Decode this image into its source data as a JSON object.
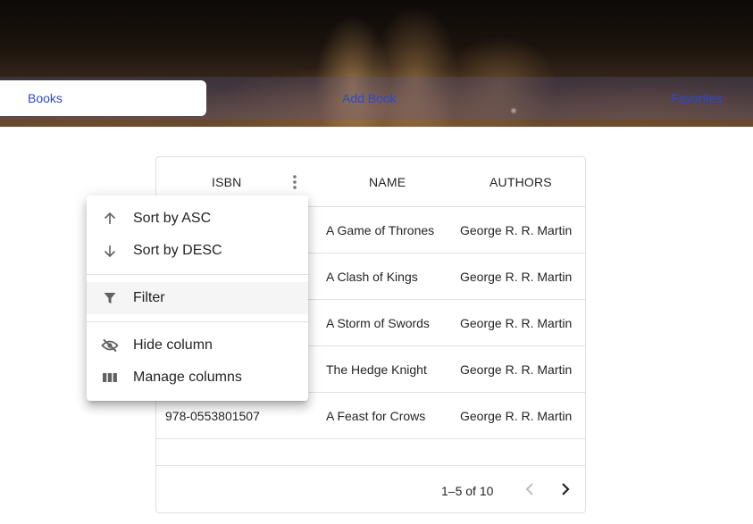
{
  "nav": {
    "books": "Books",
    "add_book": "Add Book",
    "favorites": "Favorites"
  },
  "grid": {
    "columns": {
      "isbn": "ISBN",
      "name": "NAME",
      "authors": "AUTHORS"
    },
    "rows": [
      {
        "isbn": "",
        "name": "A Game of Thrones",
        "authors": "George R. R. Martin"
      },
      {
        "isbn": "",
        "name": "A Clash of Kings",
        "authors": "George R. R. Martin"
      },
      {
        "isbn": "",
        "name": "A Storm of Swords",
        "authors": "George R. R. Martin"
      },
      {
        "isbn": "",
        "name": "The Hedge Knight",
        "authors": "George R. R. Martin"
      },
      {
        "isbn": "978-0553801507",
        "name": "A Feast for Crows",
        "authors": "George R. R. Martin"
      }
    ],
    "pagination": {
      "range": "1–5 of 10"
    }
  },
  "column_menu": {
    "sort_asc": "Sort by ASC",
    "sort_desc": "Sort by DESC",
    "filter": "Filter",
    "hide_column": "Hide column",
    "manage_columns": "Manage columns"
  },
  "colors": {
    "nav_link": "#2f49d1",
    "menu_highlight": "#f5f5f5",
    "border": "#e0e0e0"
  }
}
